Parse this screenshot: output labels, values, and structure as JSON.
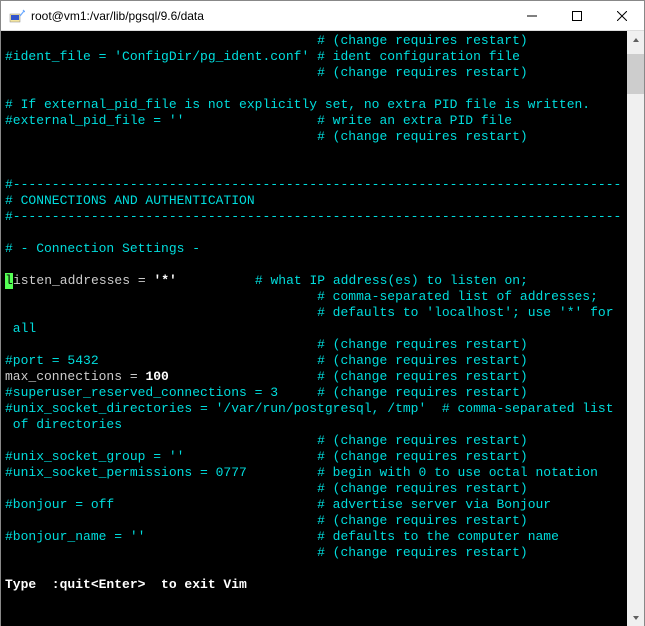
{
  "titlebar": {
    "title": "root@vm1:/var/lib/pgsql/9.6/data",
    "minimize_label": "Minimize",
    "maximize_label": "Maximize",
    "close_label": "Close"
  },
  "terminal": {
    "lines": [
      {
        "segs": [
          {
            "t": "                                        "
          },
          {
            "t": "# (change requires restart)",
            "c": "cyan"
          }
        ]
      },
      {
        "segs": [
          {
            "t": "#ident_file = 'ConfigDir/pg_ident.conf' ",
            "c": "cyan"
          },
          {
            "t": "# ident configuration file",
            "c": "cyan"
          }
        ]
      },
      {
        "segs": [
          {
            "t": "                                        "
          },
          {
            "t": "# (change requires restart)",
            "c": "cyan"
          }
        ]
      },
      {
        "segs": []
      },
      {
        "segs": [
          {
            "t": "# If external_pid_file is not explicitly set, no extra PID file is written.",
            "c": "cyan"
          }
        ]
      },
      {
        "segs": [
          {
            "t": "#external_pid_file = ''                 ",
            "c": "cyan"
          },
          {
            "t": "# write an extra PID file",
            "c": "cyan"
          }
        ]
      },
      {
        "segs": [
          {
            "t": "                                        "
          },
          {
            "t": "# (change requires restart)",
            "c": "cyan"
          }
        ]
      },
      {
        "segs": []
      },
      {
        "segs": []
      },
      {
        "segs": [
          {
            "t": "#------------------------------------------------------------------------------",
            "c": "cyan"
          }
        ]
      },
      {
        "segs": [
          {
            "t": "# CONNECTIONS AND AUTHENTICATION",
            "c": "cyan"
          }
        ]
      },
      {
        "segs": [
          {
            "t": "#------------------------------------------------------------------------------",
            "c": "cyan"
          }
        ]
      },
      {
        "segs": []
      },
      {
        "segs": [
          {
            "t": "# - Connection Settings -",
            "c": "cyan"
          }
        ]
      },
      {
        "segs": []
      },
      {
        "segs": [
          {
            "t": "l",
            "cursor": true
          },
          {
            "t": "isten_addresses = "
          },
          {
            "t": "'*'",
            "c": "bold"
          },
          {
            "t": "          "
          },
          {
            "t": "# what IP address(es) to listen on;",
            "c": "cyan"
          }
        ]
      },
      {
        "segs": [
          {
            "t": "                                        "
          },
          {
            "t": "# comma-separated list of addresses;",
            "c": "cyan"
          }
        ]
      },
      {
        "segs": [
          {
            "t": "                                        "
          },
          {
            "t": "# defaults to 'localhost'; use '*' for",
            "c": "cyan"
          }
        ]
      },
      {
        "segs": [
          {
            "t": " all",
            "c": "cyan"
          }
        ]
      },
      {
        "segs": [
          {
            "t": "                                        "
          },
          {
            "t": "# (change requires restart)",
            "c": "cyan"
          }
        ]
      },
      {
        "segs": [
          {
            "t": "#port = 5432                            ",
            "c": "cyan"
          },
          {
            "t": "# (change requires restart)",
            "c": "cyan"
          }
        ]
      },
      {
        "segs": [
          {
            "t": "max_connections = "
          },
          {
            "t": "100",
            "c": "bold"
          },
          {
            "t": "                   "
          },
          {
            "t": "# (change requires restart)",
            "c": "cyan"
          }
        ]
      },
      {
        "segs": [
          {
            "t": "#superuser_reserved_connections = 3     ",
            "c": "cyan"
          },
          {
            "t": "# (change requires restart)",
            "c": "cyan"
          }
        ]
      },
      {
        "segs": [
          {
            "t": "#unix_socket_directories = '/var/run/postgresql, /tmp'  ",
            "c": "cyan"
          },
          {
            "t": "# comma-separated list",
            "c": "cyan"
          }
        ]
      },
      {
        "segs": [
          {
            "t": " of directories",
            "c": "cyan"
          }
        ]
      },
      {
        "segs": [
          {
            "t": "                                        "
          },
          {
            "t": "# (change requires restart)",
            "c": "cyan"
          }
        ]
      },
      {
        "segs": [
          {
            "t": "#unix_socket_group = ''                 ",
            "c": "cyan"
          },
          {
            "t": "# (change requires restart)",
            "c": "cyan"
          }
        ]
      },
      {
        "segs": [
          {
            "t": "#unix_socket_permissions = 0777         ",
            "c": "cyan"
          },
          {
            "t": "# begin with 0 to use octal notation",
            "c": "cyan"
          }
        ]
      },
      {
        "segs": [
          {
            "t": "                                        "
          },
          {
            "t": "# (change requires restart)",
            "c": "cyan"
          }
        ]
      },
      {
        "segs": [
          {
            "t": "#bonjour = off                          ",
            "c": "cyan"
          },
          {
            "t": "# advertise server via Bonjour",
            "c": "cyan"
          }
        ]
      },
      {
        "segs": [
          {
            "t": "                                        "
          },
          {
            "t": "# (change requires restart)",
            "c": "cyan"
          }
        ]
      },
      {
        "segs": [
          {
            "t": "#bonjour_name = ''                      ",
            "c": "cyan"
          },
          {
            "t": "# defaults to the computer name",
            "c": "cyan"
          }
        ]
      },
      {
        "segs": [
          {
            "t": "                                        "
          },
          {
            "t": "# (change requires restart)",
            "c": "cyan"
          }
        ]
      },
      {
        "segs": []
      },
      {
        "segs": [
          {
            "t": "Type  :quit<Enter>  to exit Vim",
            "c": "bold"
          }
        ]
      }
    ]
  }
}
